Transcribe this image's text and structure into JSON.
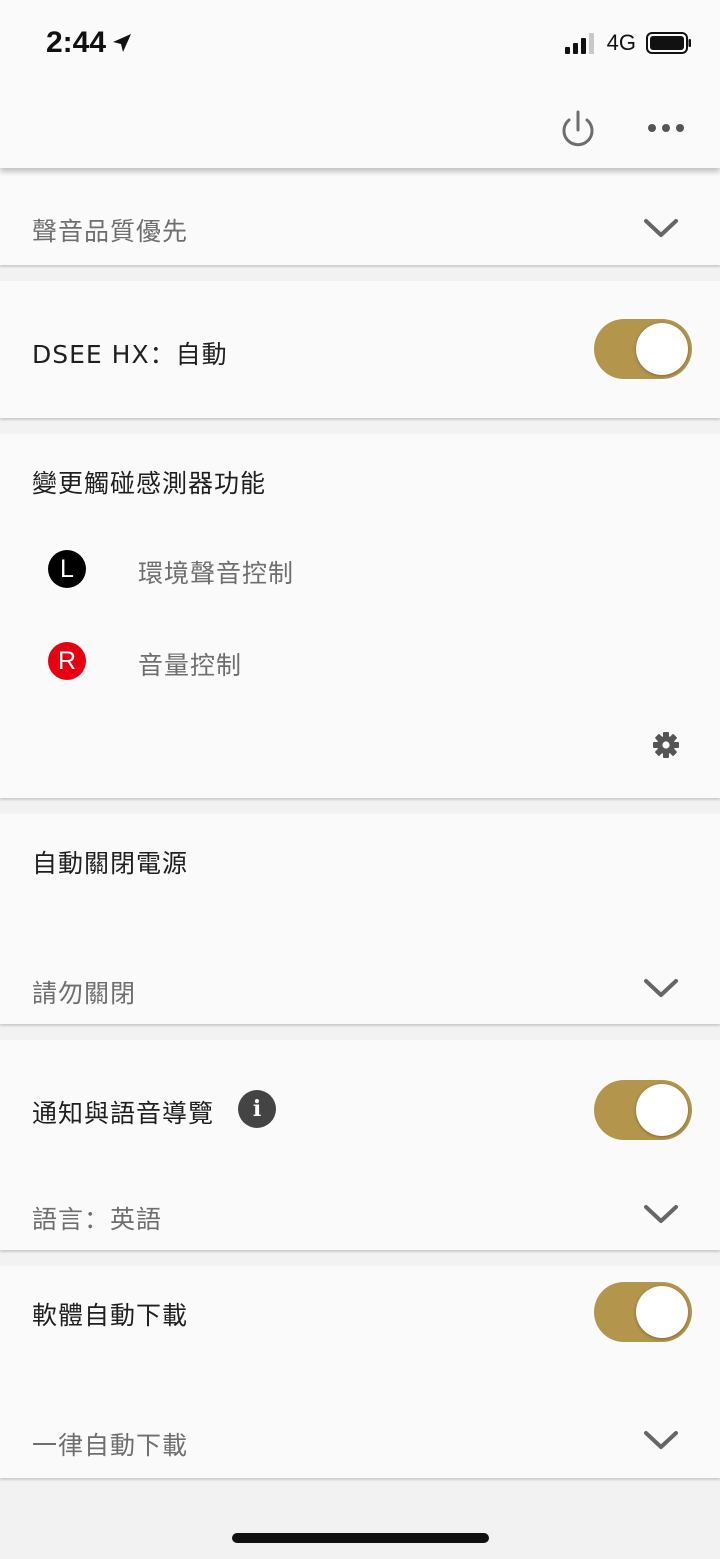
{
  "status_bar": {
    "time": "2:44",
    "carrier": "4G",
    "location_icon": "location-arrow-icon",
    "signal_icon": "signal-bars-icon",
    "battery_icon": "battery-icon"
  },
  "toolbar": {
    "power_icon": "power-icon",
    "more_icon": "more-dots-icon"
  },
  "sound_quality": {
    "value": "聲音品質優先"
  },
  "dsee": {
    "label": "DSEE HX：自動",
    "enabled": true
  },
  "touch_sensor": {
    "title": "變更觸碰感測器功能",
    "left": {
      "badge": "L",
      "label": "環境聲音控制"
    },
    "right": {
      "badge": "R",
      "label": "音量控制"
    }
  },
  "auto_power_off": {
    "title": "自動關閉電源",
    "value": "請勿關閉"
  },
  "notification": {
    "title": "通知與語音導覽",
    "info_glyph": "i",
    "enabled": true,
    "language": "語言：英語"
  },
  "software_download": {
    "title": "軟體自動下載",
    "enabled": true,
    "value": "一律自動下載"
  },
  "colors": {
    "accent": "#b3954c",
    "right_badge": "#e60012",
    "left_badge": "#000000"
  }
}
